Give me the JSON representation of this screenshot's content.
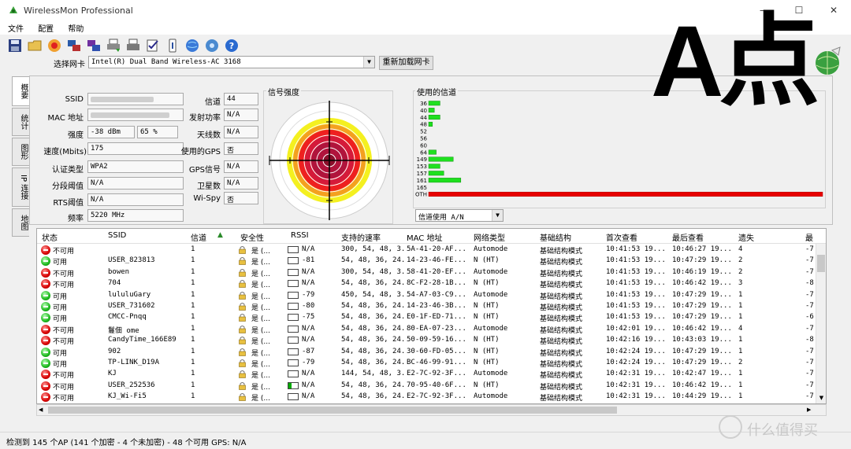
{
  "window": {
    "title": "WirelessMon Professional",
    "minimize": "—",
    "maximize": "☐",
    "close": "✕"
  },
  "menu": [
    "文件",
    "配置",
    "帮助"
  ],
  "adapter": {
    "label": "选择网卡",
    "value": "Intel(R) Dual Band Wireless-AC 3168",
    "reload": "重新加载网卡"
  },
  "tabs": [
    "概要",
    "统计",
    "图形",
    "IP 连接",
    "地图"
  ],
  "summary": {
    "ssid_label": "SSID",
    "mac_label": "MAC 地址",
    "strength_label": "强度",
    "strength_dbm": "-38 dBm",
    "strength_pct": "65 %",
    "speed_label": "速度(Mbits)",
    "speed": "175",
    "auth_label": "认证类型",
    "auth": "WPA2",
    "frag_label": "分段阈值",
    "frag": "N/A",
    "rts_label": "RTS阈值",
    "rts": "N/A",
    "freq_label": "频率",
    "freq": "5220 MHz",
    "channel_label": "信道",
    "channel": "44",
    "txpower_label": "发射功率",
    "txpower": "N/A",
    "antennas_label": "天线数",
    "antennas": "N/A",
    "gps_used_label": "使用的GPS",
    "gps_used": "否",
    "gps_signal_label": "GPS信号",
    "gps_signal": "N/A",
    "satellites_label": "卫星数",
    "satellites": "N/A",
    "wispy_label": "Wi-Spy",
    "wispy": "否"
  },
  "signal": {
    "label": "信号强度"
  },
  "channels": {
    "label": "使用的信道",
    "rows": [
      {
        "ch": "36",
        "level": 0.12
      },
      {
        "ch": "40",
        "level": 0.06
      },
      {
        "ch": "44",
        "level": 0.12
      },
      {
        "ch": "48",
        "level": 0.04
      },
      {
        "ch": "52",
        "level": 0
      },
      {
        "ch": "56",
        "level": 0
      },
      {
        "ch": "60",
        "level": 0
      },
      {
        "ch": "64",
        "level": 0.08
      },
      {
        "ch": "149",
        "level": 0.26
      },
      {
        "ch": "153",
        "level": 0.12
      },
      {
        "ch": "157",
        "level": 0.16
      },
      {
        "ch": "161",
        "level": 0.34
      },
      {
        "ch": "165",
        "level": 0
      },
      {
        "ch": "OTH",
        "level": 1.0
      }
    ],
    "select_value": "信道使用 A/N",
    "bar_color": "#1ee01e",
    "other_color": "#e80000"
  },
  "list": {
    "headers": [
      "状态",
      "SSID",
      "信道",
      "安全性",
      "RSSI",
      "支持的速率",
      "MAC 地址",
      "网络类型",
      "基础结构",
      "首次查看",
      "最后查看",
      "遗失",
      "最"
    ],
    "rows": [
      {
        "status": "不可用",
        "ok": false,
        "ssid": "",
        "ch": "1",
        "sec": "是 (...",
        "rssi": "N/A",
        "rssi_level": 0,
        "rates": "300, 54, 48, 3...",
        "mac": "5A-41-20-AF...",
        "type": "Automode",
        "infra": "基础结构模式",
        "first": "10:41:53 19...",
        "last": "10:46:27 19...",
        "lost": "4",
        "max": "-7"
      },
      {
        "status": "可用",
        "ok": true,
        "ssid": "USER_823813",
        "ch": "1",
        "sec": "是 (...",
        "rssi": "-81",
        "rssi_level": 0,
        "rates": "54, 48, 36, 24...",
        "mac": "14-23-46-FE...",
        "type": "N (HT)",
        "infra": "基础结构模式",
        "first": "10:41:53 19...",
        "last": "10:47:29 19...",
        "lost": "2",
        "max": "-7"
      },
      {
        "status": "不可用",
        "ok": false,
        "ssid": "bowen",
        "ch": "1",
        "sec": "是 (...",
        "rssi": "N/A",
        "rssi_level": 0,
        "rates": "300, 54, 48, 3...",
        "mac": "58-41-20-EF...",
        "type": "Automode",
        "infra": "基础结构模式",
        "first": "10:41:53 19...",
        "last": "10:46:19 19...",
        "lost": "2",
        "max": "-7"
      },
      {
        "status": "不可用",
        "ok": false,
        "ssid": "704",
        "ch": "1",
        "sec": "是 (...",
        "rssi": "N/A",
        "rssi_level": 0,
        "rates": "54, 48, 36, 24...",
        "mac": "8C-F2-28-1B...",
        "type": "N (HT)",
        "infra": "基础结构模式",
        "first": "10:41:53 19...",
        "last": "10:46:42 19...",
        "lost": "3",
        "max": "-8"
      },
      {
        "status": "可用",
        "ok": true,
        "ssid": "lululuGary",
        "ch": "1",
        "sec": "是 (...",
        "rssi": "-79",
        "rssi_level": 0,
        "rates": "450, 54, 48, 3...",
        "mac": "54-A7-03-C9...",
        "type": "Automode",
        "infra": "基础结构模式",
        "first": "10:41:53 19...",
        "last": "10:47:29 19...",
        "lost": "1",
        "max": "-7"
      },
      {
        "status": "可用",
        "ok": true,
        "ssid": "USER_731602",
        "ch": "1",
        "sec": "是 (...",
        "rssi": "-80",
        "rssi_level": 0,
        "rates": "54, 48, 36, 24...",
        "mac": "14-23-46-3B...",
        "type": "N (HT)",
        "infra": "基础结构模式",
        "first": "10:41:53 19...",
        "last": "10:47:29 19...",
        "lost": "1",
        "max": "-7"
      },
      {
        "status": "可用",
        "ok": true,
        "ssid": "CMCC-Pnqq",
        "ch": "1",
        "sec": "是 (...",
        "rssi": "-75",
        "rssi_level": 0,
        "rates": "54, 48, 36, 24...",
        "mac": "E0-1F-ED-71...",
        "type": "N (HT)",
        "infra": "基础结构模式",
        "first": "10:41:53 19...",
        "last": "10:47:29 19...",
        "lost": "1",
        "max": "-6"
      },
      {
        "status": "不可用",
        "ok": false,
        "ssid": "鬘佃  ome",
        "ch": "1",
        "sec": "是 (...",
        "rssi": "N/A",
        "rssi_level": 0,
        "rates": "54, 48, 36, 24...",
        "mac": "80-EA-07-23...",
        "type": "Automode",
        "infra": "基础结构模式",
        "first": "10:42:01 19...",
        "last": "10:46:42 19...",
        "lost": "4",
        "max": "-7"
      },
      {
        "status": "不可用",
        "ok": false,
        "ssid": "CandyTime_166E89",
        "ch": "1",
        "sec": "是 (...",
        "rssi": "N/A",
        "rssi_level": 0,
        "rates": "54, 48, 36, 24...",
        "mac": "50-09-59-16...",
        "type": "N (HT)",
        "infra": "基础结构模式",
        "first": "10:42:16 19...",
        "last": "10:43:03 19...",
        "lost": "1",
        "max": "-8"
      },
      {
        "status": "可用",
        "ok": true,
        "ssid": "902",
        "ch": "1",
        "sec": "是 (...",
        "rssi": "-87",
        "rssi_level": 0,
        "rates": "54, 48, 36, 24...",
        "mac": "30-60-FD-05...",
        "type": "N (HT)",
        "infra": "基础结构模式",
        "first": "10:42:24 19...",
        "last": "10:47:29 19...",
        "lost": "1",
        "max": "-7"
      },
      {
        "status": "可用",
        "ok": true,
        "ssid": "TP-LINK_D19A",
        "ch": "1",
        "sec": "是 (...",
        "rssi": "-79",
        "rssi_level": 0,
        "rates": "54, 48, 36, 24...",
        "mac": "BC-46-99-91...",
        "type": "N (HT)",
        "infra": "基础结构模式",
        "first": "10:42:24 19...",
        "last": "10:47:29 19...",
        "lost": "2",
        "max": "-7"
      },
      {
        "status": "不可用",
        "ok": false,
        "ssid": "KJ",
        "ch": "1",
        "sec": "是 (...",
        "rssi": "N/A",
        "rssi_level": 0,
        "rates": "144, 54, 48, 3...",
        "mac": "E2-7C-92-3F...",
        "type": "Automode",
        "infra": "基础结构模式",
        "first": "10:42:31 19...",
        "last": "10:42:47 19...",
        "lost": "1",
        "max": "-7"
      },
      {
        "status": "不可用",
        "ok": false,
        "ssid": "USER_252536",
        "ch": "1",
        "sec": "是 (...",
        "rssi": "N/A",
        "rssi_level": 0.3,
        "rates": "54, 48, 36, 24...",
        "mac": "70-95-40-6F...",
        "type": "N (HT)",
        "infra": "基础结构模式",
        "first": "10:42:31 19...",
        "last": "10:46:42 19...",
        "lost": "1",
        "max": "-7"
      },
      {
        "status": "不可用",
        "ok": false,
        "ssid": "KJ_Wi-Fi5",
        "ch": "1",
        "sec": "是 (...",
        "rssi": "N/A",
        "rssi_level": 0,
        "rates": "54, 48, 36, 24...",
        "mac": "E2-7C-92-3F...",
        "type": "Automode",
        "infra": "基础结构模式",
        "first": "10:42:31 19...",
        "last": "10:44:29 19...",
        "lost": "1",
        "max": "-7"
      }
    ]
  },
  "statusbar": "检测到 145 个AP (141 个加密 - 4 个未加密) - 48 个可用  GPS: N/A",
  "overlay_text": "A点",
  "watermark": "什么值得买"
}
